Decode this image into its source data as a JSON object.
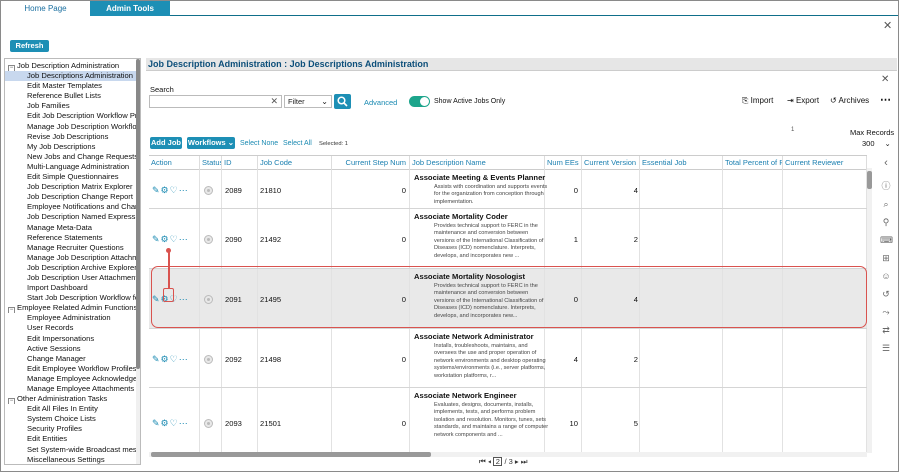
{
  "tabs": [
    {
      "label": "Home Page"
    },
    {
      "label": "Admin Tools"
    }
  ],
  "refresh_label": "Refresh",
  "tree": [
    {
      "label": "Job Description Administration",
      "type": "group"
    },
    {
      "label": "Job Descriptions Administration",
      "type": "leaf",
      "selected": true
    },
    {
      "label": "Edit Master Templates",
      "type": "leaf"
    },
    {
      "label": "Reference Bullet Lists",
      "type": "leaf"
    },
    {
      "label": "Job Families",
      "type": "leaf"
    },
    {
      "label": "Edit Job Description Workflow Prof",
      "type": "leaf"
    },
    {
      "label": "Manage Job Description Workflows",
      "type": "leaf"
    },
    {
      "label": "Revise Job Descriptions",
      "type": "leaf"
    },
    {
      "label": "My Job Descriptions",
      "type": "leaf"
    },
    {
      "label": "New Jobs and Change Requests Ac",
      "type": "leaf"
    },
    {
      "label": "Multi-Language Administration",
      "type": "leaf"
    },
    {
      "label": "Edit Simple Questionnaires",
      "type": "leaf"
    },
    {
      "label": "Job Description Matrix Explorer",
      "type": "leaf"
    },
    {
      "label": "Job Description Change Report",
      "type": "leaf"
    },
    {
      "label": "Employee Notifications and Chang",
      "type": "leaf"
    },
    {
      "label": "Job Description Named Expression",
      "type": "leaf"
    },
    {
      "label": "Manage Meta-Data",
      "type": "leaf"
    },
    {
      "label": "Reference Statements",
      "type": "leaf"
    },
    {
      "label": "Manage Recruiter Questions",
      "type": "leaf"
    },
    {
      "label": "Manage Job Description Attachme",
      "type": "leaf"
    },
    {
      "label": "Job Description Archive Explorer",
      "type": "leaf"
    },
    {
      "label": "Job Description User Attachments",
      "type": "leaf"
    },
    {
      "label": "Import Dashboard",
      "type": "leaf"
    },
    {
      "label": "Start Job Description Workflow for",
      "type": "leaf"
    },
    {
      "label": "Employee Related Admin Functions",
      "type": "group"
    },
    {
      "label": "Employee Administration",
      "type": "leaf"
    },
    {
      "label": "User Records",
      "type": "leaf"
    },
    {
      "label": "Edit Impersonations",
      "type": "leaf"
    },
    {
      "label": "Active Sessions",
      "type": "leaf"
    },
    {
      "label": "Change Manager",
      "type": "leaf"
    },
    {
      "label": "Edit Employee Workflow Profiles",
      "type": "leaf"
    },
    {
      "label": "Manage Employee Acknowledgeme",
      "type": "leaf"
    },
    {
      "label": "Manage Employee Attachments",
      "type": "leaf"
    },
    {
      "label": "Other Administration Tasks",
      "type": "group"
    },
    {
      "label": "Edit All Files In Entity",
      "type": "leaf"
    },
    {
      "label": "System Choice Lists",
      "type": "leaf"
    },
    {
      "label": "Security Profiles",
      "type": "leaf"
    },
    {
      "label": "Edit Entities",
      "type": "leaf"
    },
    {
      "label": "Set System-wide Broadcast messa",
      "type": "leaf"
    },
    {
      "label": "Miscellaneous Settings",
      "type": "leaf"
    }
  ],
  "panel": {
    "title": "Job Description Administration : Job Descriptions Administration",
    "search_label": "Search",
    "search_value": "",
    "filter_value": "Filter",
    "advanced_label": "Advanced",
    "show_active_label": "Show Active Jobs Only",
    "import_label": "Import",
    "export_label": "Export",
    "archives_label": "Archives",
    "add_job_label": "Add Job",
    "workflows_label": "Workflows",
    "select_none_label": "Select None",
    "select_all_label": "Select All",
    "selected_count_label": "Selected: 1",
    "max_records_label": "Max Records",
    "max_records_value": "300",
    "marker_value": "1"
  },
  "columns": [
    "Action",
    "Status",
    "ID",
    "Job Code",
    "Current Step Num",
    "Job Description Name",
    "Num EEs",
    "Current Version",
    "Essential Job",
    "Total Percent of R",
    "Current Reviewer"
  ],
  "rows": [
    {
      "id": "2089",
      "code": "21810",
      "step": "0",
      "title": "Associate Meeting & Events Planner",
      "desc": "Assists with coordination and supports events for the organization from conception through implementation.",
      "num_ees": "0",
      "version": "4"
    },
    {
      "id": "2090",
      "code": "21492",
      "step": "0",
      "title": "Associate Mortality Coder",
      "desc": "Provides technical support to FERC in the maintenance and conversion between versions of the International Classification of Diseases (ICD) nomenclature. Interprets, develops, and incorporates new ...",
      "num_ees": "1",
      "version": "2"
    },
    {
      "id": "2091",
      "code": "21495",
      "step": "0",
      "title": "Associate Mortality Nosologist",
      "desc": "Provides technical support to FERC in the maintenance and conversion between versions of the International Classification of Diseases (ICD) nomenclature. Interprets, develops, and incorporates new...",
      "num_ees": "0",
      "version": "4"
    },
    {
      "id": "2092",
      "code": "21498",
      "step": "0",
      "title": "Associate Network Administrator",
      "desc": "Installs, troubleshoots, maintains, and oversees the use and proper operation of network environments and desktop operating systems/environments (i.e., server platforms, workstation platforms, r...",
      "num_ees": "4",
      "version": "2"
    },
    {
      "id": "2093",
      "code": "21501",
      "step": "0",
      "title": "Associate Network Engineer",
      "desc": "Evaluates, designs, documents, installs, implements, tests, and performs problem isolation and resolution. Monitors, tunes, sets standards, and maintains a range of computer network components and ...",
      "num_ees": "10",
      "version": "5"
    }
  ],
  "pager": {
    "current": "2",
    "total": "/ 3"
  },
  "colors": {
    "accent": "#1d8fb5",
    "toggle": "#1da58c",
    "highlight": "#d9534f",
    "link": "#1a8ab2"
  }
}
